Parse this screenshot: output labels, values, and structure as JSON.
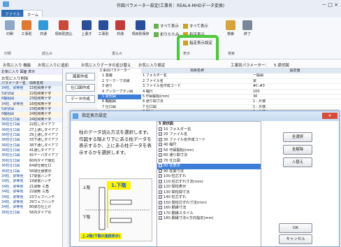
{
  "title": "作図パラメーター設定(工事名：REAL4-MHDデータ変換)",
  "tabs": [
    "ファイル",
    "ホーム"
  ],
  "ribbon": {
    "b1": "印刷",
    "b2": "工事別",
    "b3": "共通",
    "b4": "項目別読込",
    "b5": "上書き",
    "b6": "工事別",
    "b7": "共通",
    "b8": "項目別保存",
    "b9": "検索",
    "b10": "終了",
    "s1": "すべて表示",
    "s2": "折りたたみ",
    "s3": "すべて表示",
    "s4": "指定表示",
    "s5": "指定表示設定",
    "g1": "印刷",
    "g2": "読込み",
    "g3": "書込み",
    "g4": "表示",
    "g5": "検索"
  },
  "favbar": {
    "f1": "お気に入り 機能",
    "f2": "お気に入りに追加",
    "f3": "お気に入りデータの並び替え",
    "f4": "お気に入り設定",
    "param": "工事別パラメーター：",
    "paramval": "5 梁伏図"
  },
  "left": {
    "tab1": "お気に入り",
    "tab2": "図面",
    "tab3": "表示",
    "tab4": "お気に入り削除",
    "hdr1": "パラメーター名",
    "hdr2": "項目名称",
    "rows": [
      [
        "34柱、梁等他",
        "15柱和英十字"
      ],
      [
        "5梁伏図",
        "22柱和英十字"
      ],
      [
        "6軸組図",
        "23柱和英十字"
      ],
      [
        "34柱、梁等他",
        "16柱和英十字"
      ],
      [
        "5梁伏図",
        "23柱和英十字"
      ],
      [
        "6軸組図",
        "24柱和英十字"
      ],
      [
        "36柱仕口図",
        "24柱和英十字"
      ],
      [
        "36柱仕口図",
        "22柱しダイアフ"
      ],
      [
        "36柱仕口図",
        "27上通しダイアフ"
      ],
      [
        "36柱仕口図",
        "29上通しダイアフ"
      ],
      [
        "36柱仕口図",
        "33下通しダイアフ"
      ],
      [
        "36柱仕口図",
        "38下通しダイアフ"
      ],
      [
        "36柱仕口図",
        "41通しダイアフ"
      ],
      [
        "36柱仕口図",
        "42テーパダイアフ"
      ],
      [
        "36柱仕口図",
        "60内ダイア順位"
      ],
      [
        "36柱仕口図",
        "64梁仕様仕口"
      ],
      [
        "36柱仕口図",
        "5R梁仕様表示"
      ],
      [
        "34柱、梁等他",
        "17梁書ハンチ"
      ],
      [
        "34柱、梁等他",
        "19梁書ハンチ"
      ],
      [
        "34柱、梁等他",
        "21梁断 三角"
      ],
      [
        "34柱、梁等他",
        "22梁断 三角"
      ],
      [
        "34柱、梁等他",
        "23ウェブハンチ"
      ],
      [
        "34柱、梁等他",
        "29ウェブハンチ"
      ],
      [
        "34柱、梁等他",
        "80梁芯仕上げ"
      ],
      [
        "36柱仕口図",
        "56内ダイアの"
      ]
    ]
  },
  "mid": {
    "b1": "図面作成",
    "b2": "仕口図作成",
    "b3": "データ作成"
  },
  "tree": {
    "t0": "工事別パラメーター",
    "t1": "1 基礎",
    "t2": "2 マーク・寸法線",
    "t3": "3 通り",
    "t4": "4 アンカープラン図",
    "t5": "5 梁伏図",
    "t6": "6 軸組図",
    "t7": "7 仕口図"
  },
  "grid": {
    "h1": "項目名称",
    "h2": "設定値",
    "rows": [
      [
        "1 フォルダー名",
        "一般図"
      ],
      [
        "2 ファイル名",
        "梁"
      ],
      [
        "3 ファイル名作成コード",
        "#C-#3"
      ],
      [
        "4 縮尺",
        "100"
      ],
      [
        "5 作図開始(mm)",
        "30"
      ],
      [
        "6 通り間寸法",
        "1 - 片側"
      ],
      [
        "7 仕口図",
        "1 - 片側"
      ],
      [
        "8 縮尺",
        "1 - 片側"
      ]
    ]
  },
  "dialog": {
    "title": "指定表示設定",
    "desc": "柱のデータ読込方法を選択します。\n作図する階より下にある柱データを表示するか、上にある柱データを表示するかを選択します。",
    "label1": "1.下階",
    "label2": "上.2階(下階の連続表示)",
    "fig_top": "上階",
    "fig_bottom": "下階",
    "list_title": "5 梁伏図",
    "items": [
      [
        "1",
        "10 フォルダー名"
      ],
      [
        "1",
        "20 ファイル名"
      ],
      [
        "1",
        "30 ファイル名作成コード"
      ],
      [
        "1",
        "40 縮尺"
      ],
      [
        "1",
        "50 作図開始(mm)"
      ],
      [
        "1",
        "60 通り間寸法"
      ],
      [
        "1",
        "70 仕口図"
      ],
      [
        "0",
        "80 柱表示"
      ],
      [
        "1",
        "90 柱間寸法"
      ],
      [
        "1",
        "100 柱芯ずれ"
      ],
      [
        "1",
        "110 柱芯ずれ寸法(mm)"
      ],
      [
        "1",
        "120 間柱表示"
      ],
      [
        "1",
        "130 間柱間寸法"
      ],
      [
        "1",
        "140 柱芯ずれ"
      ],
      [
        "1",
        "150 間柱芯ずれ寸法(mm)"
      ],
      [
        "1",
        "160 胴縁寸法"
      ],
      [
        "1",
        "170 胴縁スタイル"
      ],
      [
        "1",
        "180 胴縁寸法×方向指定(mm)"
      ]
    ],
    "btn_all": "全選択",
    "btn_clear": "全解除",
    "btn_swap": "入替え",
    "btn_ok": "OK",
    "btn_cancel": "キャンセル"
  },
  "colors": {
    "accent": "#2e6db5",
    "highlight": "#4cc83a",
    "dialogTitle": "#c7dbf1",
    "selected": "#3d7fd6"
  }
}
